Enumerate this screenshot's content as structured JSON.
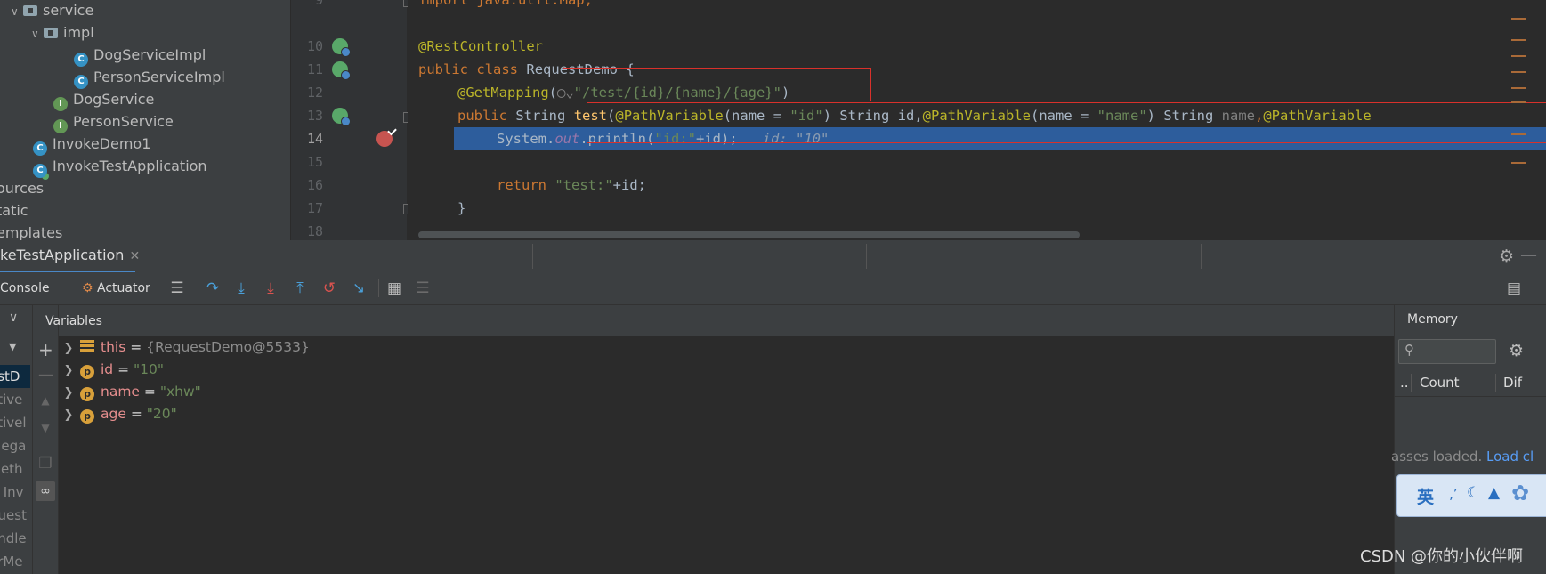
{
  "project_tree": {
    "items": [
      {
        "label": "service",
        "kind": "folder",
        "expanded": true
      },
      {
        "label": "impl",
        "kind": "folder",
        "expanded": true
      },
      {
        "label": "DogServiceImpl",
        "kind": "class"
      },
      {
        "label": "PersonServiceImpl",
        "kind": "class"
      },
      {
        "label": "DogService",
        "kind": "interface"
      },
      {
        "label": "PersonService",
        "kind": "interface"
      },
      {
        "label": "InvokeDemo1",
        "kind": "class"
      },
      {
        "label": "InvokeTestApplication",
        "kind": "spring-boot-app"
      },
      {
        "label": "ources",
        "kind": "folder"
      },
      {
        "label": "tatic",
        "kind": "folder"
      },
      {
        "label": "emplates",
        "kind": "folder"
      }
    ]
  },
  "editor": {
    "line_numbers": [
      "9",
      "10",
      "11",
      "12",
      "13",
      "14",
      "15",
      "16",
      "17",
      "18"
    ],
    "current_line": "14",
    "code_line_9": "import java.util.Map;",
    "annotation_rest": "@RestController",
    "kw_public": "public",
    "kw_class": "class",
    "class_name": "RequestDemo",
    "brace_open": "{",
    "annotation_get": "@GetMapping",
    "mapping_path": "\"/test/{id}/{name}/{age}\"",
    "kw_string": "String",
    "method_name": "test",
    "pathvar_annot": "@PathVariable",
    "param_name_kw": "name = ",
    "param_id_str": "\"id\"",
    "param_id_rest": ") String id,",
    "param_name_str": "\"name\"",
    "param_name_rest": ") String ",
    "param_name_var": "name",
    "line14_code": "System.",
    "line14_out": "out",
    "line14_println": ".println(",
    "line14_str": "\"id:\"",
    "line14_rest": "+id);",
    "line14_hint": "id: \"10\"",
    "kw_return": "return",
    "line16_str": "\"test:\"",
    "line16_rest": "+id;",
    "brace_close": "}"
  },
  "debug": {
    "tab_title": "keTestApplication",
    "toolbar": {
      "console_label": "Console",
      "actuator_label": "Actuator"
    },
    "variables_header": "Variables",
    "frames": [
      "estD",
      "ative",
      "ativel",
      "elega",
      "Meth",
      "r, Inv",
      "quest",
      "andle",
      "erMe"
    ],
    "variables": [
      {
        "name": "this",
        "value": "{RequestDemo@5533}",
        "badge": "field"
      },
      {
        "name": "id",
        "value": "\"10\"",
        "badge": "p"
      },
      {
        "name": "name",
        "value": "\"xhw\"",
        "badge": "p"
      },
      {
        "name": "age",
        "value": "\"20\"",
        "badge": "p"
      }
    ],
    "memory": {
      "header": "Memory",
      "col_prefix": "..",
      "col_count": "Count",
      "col_diff": "Dif",
      "status_text": "asses loaded.",
      "status_link": "Load cl"
    }
  },
  "ime": {
    "label": "英"
  },
  "watermark": "CSDN @你的小伙伴啊",
  "colors": {
    "highlight_line": "#2d5d9c",
    "annotation_box": "#d9312b",
    "keyword": "#cc7832",
    "string": "#6a8759"
  }
}
